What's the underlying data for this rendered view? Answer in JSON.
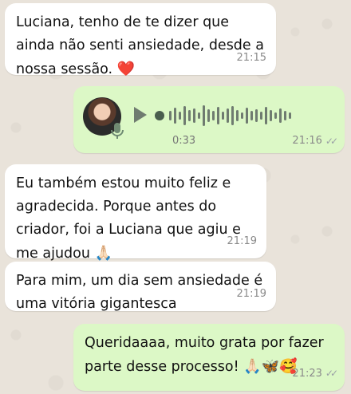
{
  "messages": [
    {
      "id": "m1",
      "direction": "in",
      "text": "Luciana, tenho de te dizer que\nainda não senti ansiedade, desde a\nnossa sessão.",
      "emoji": "❤️",
      "time": "21:15"
    },
    {
      "id": "m2",
      "direction": "out",
      "type": "voice",
      "duration": "0:33",
      "time": "21:16",
      "status": "read"
    },
    {
      "id": "m3",
      "direction": "in",
      "text": "Eu também estou muito feliz e\nagradecida. Porque antes do\ncriador, foi a Luciana que agiu e\nme ajudou",
      "emoji": "🙏🏻",
      "time": "21:19"
    },
    {
      "id": "m4",
      "direction": "in",
      "text": "Para mim, um dia sem ansiedade é\numa vitória gigantesca",
      "time": "21:19"
    },
    {
      "id": "m5",
      "direction": "out",
      "text": "Queridaaaa, muito grata por fazer\nparte desse processo!",
      "emoji": "🙏🏻🦋🥰",
      "time": "21:23",
      "status": "read"
    }
  ],
  "colors": {
    "chat_background": "#e9e3da",
    "incoming_bubble": "#ffffff",
    "outgoing_bubble": "#dcf8c6"
  },
  "icons": {
    "read_status": "double-check-icon",
    "play": "play-icon",
    "mic": "microphone-icon"
  }
}
